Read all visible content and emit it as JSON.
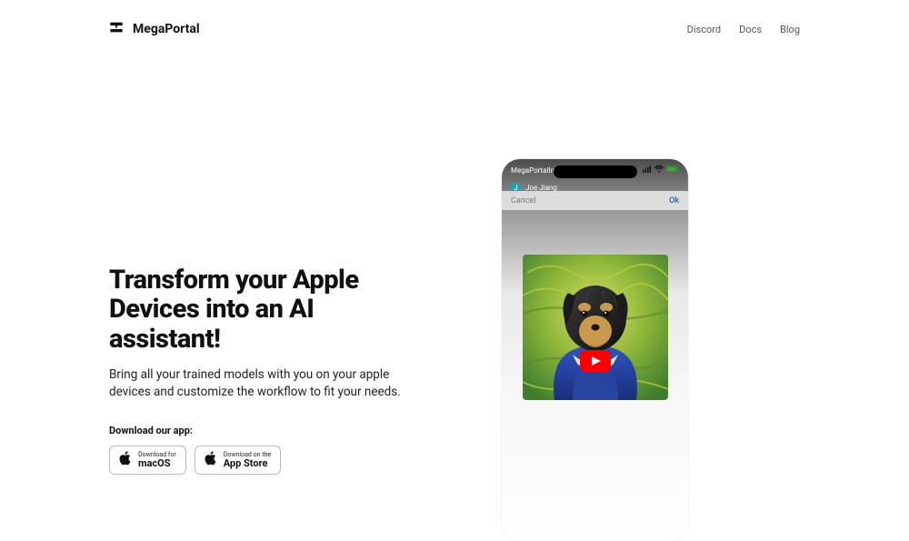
{
  "header": {
    "brand": "MegaPortal",
    "nav": [
      {
        "label": "Discord"
      },
      {
        "label": "Docs"
      },
      {
        "label": "Blog"
      }
    ]
  },
  "hero": {
    "title": "Transform your Apple Devices into an AI assistant!",
    "subtitle": "Bring all your trained models with you on your apple devices and customize the workflow to fit your needs.",
    "download_label": "Download our app:",
    "buttons": [
      {
        "top": "Download for",
        "bottom": "macOS"
      },
      {
        "top": "Download on the",
        "bottom": "App Store"
      }
    ]
  },
  "phone": {
    "status_left": "MegaPortalIntro",
    "user_initial": "J",
    "user_name": "Joe Jiang",
    "overlay_cancel": "Cancel",
    "overlay_ok": "Ok"
  }
}
